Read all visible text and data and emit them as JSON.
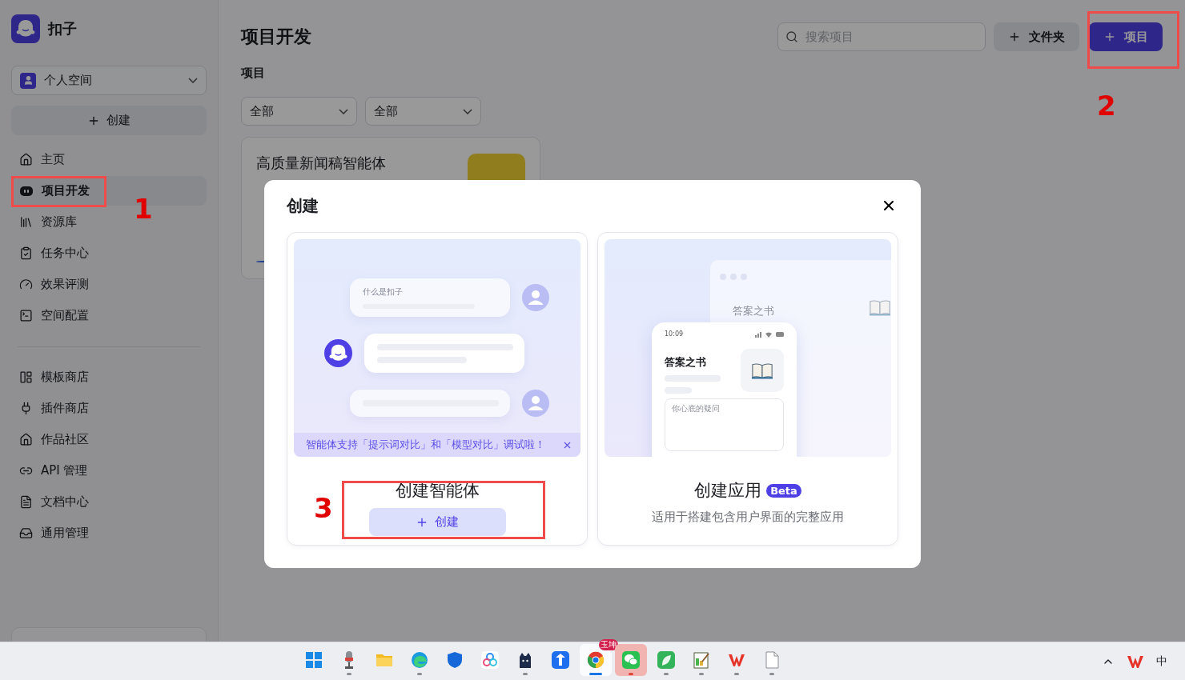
{
  "app": {
    "name": "扣子"
  },
  "sidebar": {
    "space": "个人空间",
    "create": "创建",
    "nav_main": [
      {
        "label": "主页",
        "selected": false
      },
      {
        "label": "项目开发",
        "selected": true
      },
      {
        "label": "资源库",
        "selected": false
      },
      {
        "label": "任务中心",
        "selected": false
      },
      {
        "label": "效果评测",
        "selected": false
      },
      {
        "label": "空间配置",
        "selected": false
      }
    ],
    "nav_store": [
      {
        "label": "模板商店",
        "selected": false
      },
      {
        "label": "插件商店",
        "selected": false
      },
      {
        "label": "作品社区",
        "selected": false
      },
      {
        "label": "API 管理",
        "selected": false
      },
      {
        "label": "文档中心",
        "selected": false
      },
      {
        "label": "通用管理",
        "selected": false
      }
    ]
  },
  "header": {
    "title": "项目开发",
    "search_placeholder": "搜索项目",
    "folder_button": "文件夹",
    "project_button": "项目"
  },
  "section": "项目",
  "filters": [
    "全部",
    "全部"
  ],
  "project_card": {
    "title": "高质量新闻稿智能体"
  },
  "dialog": {
    "title": "创建",
    "options": [
      {
        "kind": "agent",
        "title": "创建智能体",
        "button": "创建",
        "banner": "智能体支持「提示词对比」和「模型对比」调试啦！",
        "question": "什么是扣子"
      },
      {
        "kind": "app",
        "title": "创建应用",
        "badge": "Beta",
        "description": "适用于搭建包含用户界面的完整应用",
        "window_title": "答案之书",
        "phone_title": "答案之书",
        "time": "10:09",
        "input_placeholder": "你心底的疑问"
      }
    ]
  },
  "annotations": [
    {
      "label": "1"
    },
    {
      "label": "2"
    },
    {
      "label": "3"
    }
  ],
  "taskbar": {
    "apps": [
      {
        "running": false,
        "selected": false,
        "attention": false
      },
      {
        "running": true,
        "selected": false,
        "attention": false
      },
      {
        "running": false,
        "selected": false,
        "attention": false
      },
      {
        "running": true,
        "selected": false,
        "attention": false
      },
      {
        "running": false,
        "selected": false,
        "attention": false
      },
      {
        "running": false,
        "selected": false,
        "attention": false
      },
      {
        "running": true,
        "selected": false,
        "attention": false
      },
      {
        "running": false,
        "selected": false,
        "attention": false
      },
      {
        "running": true,
        "selected": true,
        "attention": false,
        "badge": "玉坤"
      },
      {
        "running": true,
        "selected": false,
        "attention": true
      },
      {
        "running": true,
        "selected": false,
        "attention": false
      },
      {
        "running": true,
        "selected": false,
        "attention": false
      },
      {
        "running": true,
        "selected": false,
        "attention": false
      },
      {
        "running": true,
        "selected": false,
        "attention": false
      }
    ],
    "input_method": "中"
  }
}
